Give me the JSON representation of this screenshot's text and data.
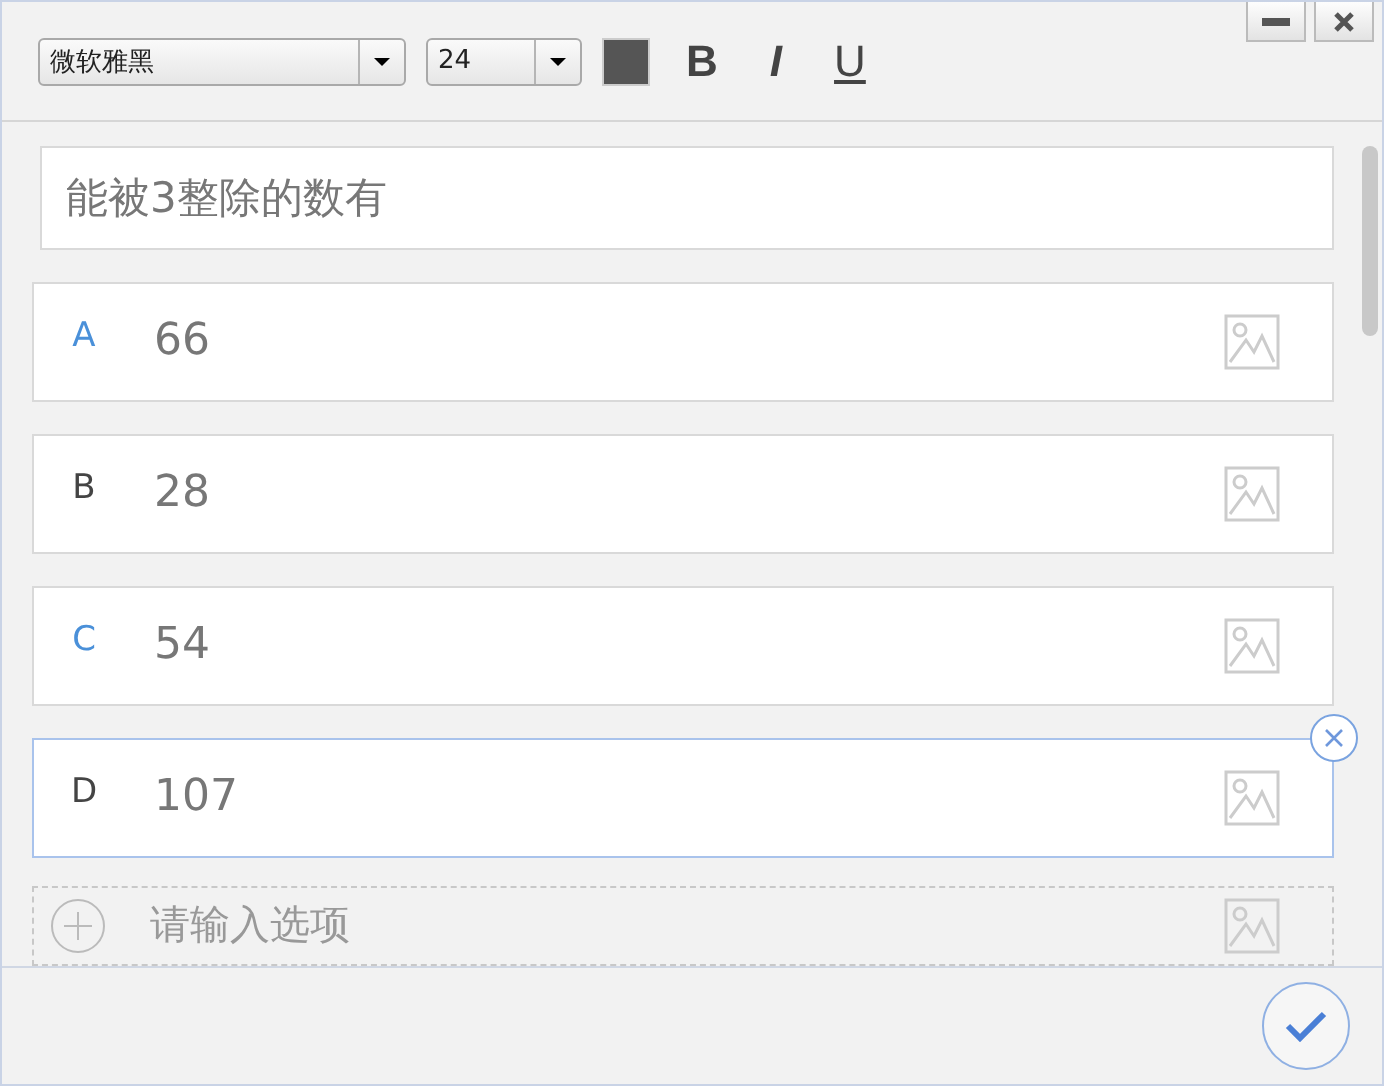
{
  "toolbar": {
    "font": "微软雅黑",
    "size": "24",
    "bold": "B",
    "italic": "I",
    "underline": "U"
  },
  "question": "能被3整除的数有",
  "options": [
    {
      "letter": "A",
      "text": "66",
      "correct": true,
      "focused": false
    },
    {
      "letter": "B",
      "text": "28",
      "correct": false,
      "focused": false
    },
    {
      "letter": "C",
      "text": "54",
      "correct": true,
      "focused": false
    },
    {
      "letter": "D",
      "text": "107",
      "correct": false,
      "focused": true
    }
  ],
  "add_option": {
    "placeholder": "请输入选项"
  }
}
